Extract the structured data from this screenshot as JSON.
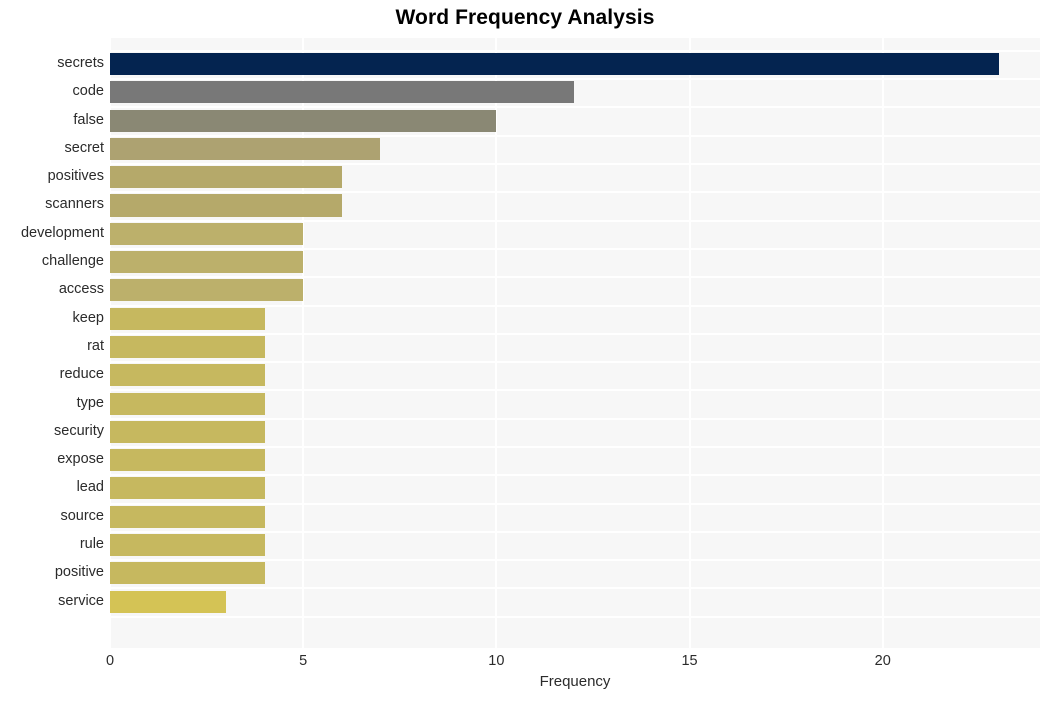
{
  "chart_data": {
    "type": "bar",
    "orientation": "horizontal",
    "title": "Word Frequency Analysis",
    "xlabel": "Frequency",
    "ylabel": "",
    "categories": [
      "secrets",
      "code",
      "false",
      "secret",
      "positives",
      "scanners",
      "development",
      "challenge",
      "access",
      "keep",
      "rat",
      "reduce",
      "type",
      "security",
      "expose",
      "lead",
      "source",
      "rule",
      "positive",
      "service"
    ],
    "values": [
      23,
      12,
      10,
      7,
      6,
      6,
      5,
      5,
      5,
      4,
      4,
      4,
      4,
      4,
      4,
      4,
      4,
      4,
      4,
      3
    ],
    "bar_colors": [
      "#042450",
      "#787878",
      "#8a8874",
      "#ada271",
      "#b5a96a",
      "#b5a96a",
      "#bcb06b",
      "#bcb06b",
      "#bcb06b",
      "#c6b85f",
      "#c6b85f",
      "#c6b85f",
      "#c6b85f",
      "#c6b85f",
      "#c6b85f",
      "#c6b85f",
      "#c6b85f",
      "#c6b85f",
      "#c6b85f",
      "#d4c355"
    ],
    "xticks": [
      0,
      5,
      10,
      15,
      20
    ],
    "xtick_labels": [
      "0",
      "5",
      "10",
      "15",
      "20"
    ],
    "xlim": [
      0,
      24.07
    ],
    "grid": true,
    "grid_color": "#ffffff",
    "plot_background": "#f7f7f7",
    "figure_background": "#ffffff",
    "legend": null
  }
}
